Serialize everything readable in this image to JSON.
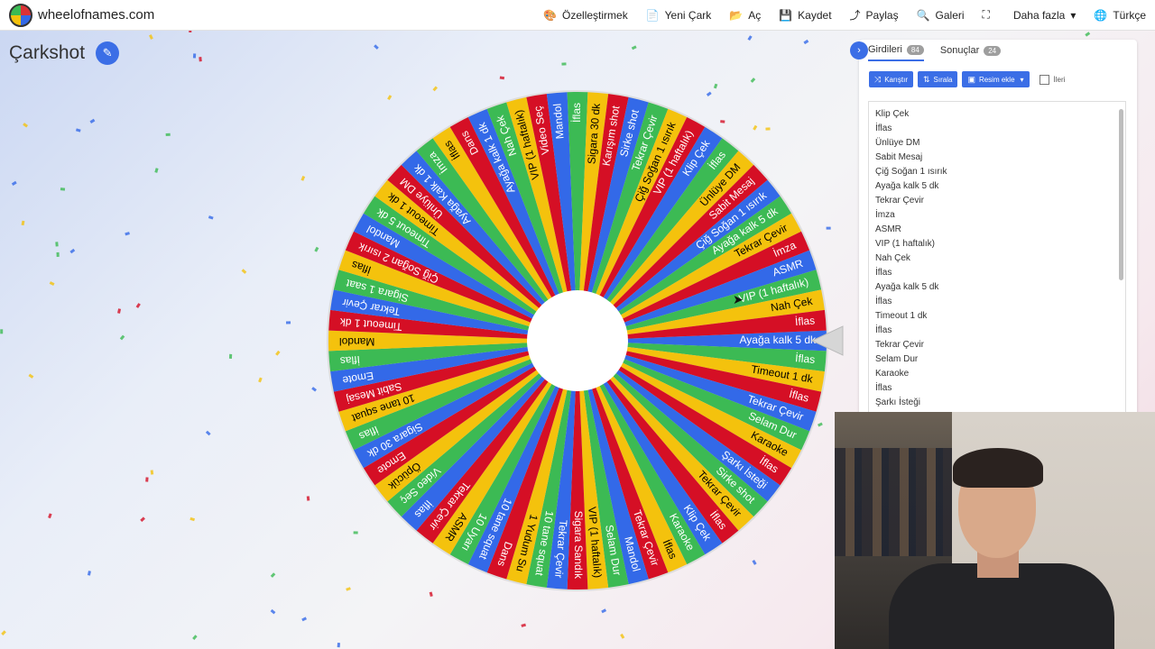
{
  "site": {
    "name": "wheelofnames.com"
  },
  "nav": [
    {
      "icon": "palette-icon",
      "glyph": "🎨",
      "label": "Özelleştirmek"
    },
    {
      "icon": "file-icon",
      "glyph": "📄",
      "label": "Yeni Çark"
    },
    {
      "icon": "folder-open-icon",
      "glyph": "📂",
      "label": "Aç"
    },
    {
      "icon": "save-icon",
      "glyph": "💾",
      "label": "Kaydet"
    },
    {
      "icon": "share-icon",
      "glyph": "⤴",
      "label": "Paylaş"
    },
    {
      "icon": "search-icon",
      "glyph": "🔍",
      "label": "Galeri"
    },
    {
      "icon": "fullscreen-icon",
      "glyph": "⛶",
      "label": ""
    },
    {
      "icon": "chevron-down-icon",
      "glyph": "▾",
      "label": "Daha fazla"
    },
    {
      "icon": "globe-icon",
      "glyph": "🌐",
      "label": "Türkçe"
    }
  ],
  "wheel": {
    "title": "Çarkshot",
    "colors": [
      "#3369e8",
      "#3cba54",
      "#f4c20d",
      "#d50f25"
    ],
    "segments": [
      "Ayağa kalk 5 dk",
      "İflas",
      "Timeout 1 dk",
      "İflas",
      "Tekrar Çevir",
      "Selam Dur",
      "Karaoke",
      "İflas",
      "Şarkı İsteği",
      "Sirke shot",
      "Tekrar Çevir",
      "İflas",
      "Klip Çek",
      "Karaoke",
      "İflas",
      "Tekrar Çevir",
      "Mandol",
      "Selam Dur",
      "VIP (1 haftalık)",
      "Sigara Sandık",
      "Tekrar Çevir",
      "10 tane squat",
      "1 Yudum Su",
      "Dans",
      "10 tane squat",
      "10 Uyarı",
      "ASMR",
      "Tekrar Çevir",
      "İflas",
      "Video Seç",
      "Öpücük",
      "Emote",
      "Sigara 30 dk",
      "İflas",
      "10 tane squat",
      "Sabit Mesaj",
      "Emote",
      "İflas",
      "Mandol",
      "Timeout 1 dk",
      "Tekrar Çevir",
      "Sigara 1 saat",
      "İflas",
      "Çiğ Soğan 2 ısırık",
      "Mandol",
      "Timeout 5 dk",
      "Timeout 1 dk",
      "Ünlüye DM",
      "Ayağa Kalk 1 dk",
      "İmza",
      "İflas",
      "Dans",
      "Ayağa kalk 1 dk",
      "Nah Çek",
      "VIP (1 haftalık)",
      "Video Seç",
      "Mandol",
      "İflas",
      "Sigara 30 dk",
      "Karışım shot",
      "Sirke shot",
      "Tekrar Çevir",
      "Çiğ Soğan 1 ısırık",
      "VIP (1 haftalık)",
      "Klip Çek",
      "İflas",
      "Ünlüye DM",
      "Sabit Mesaj",
      "Çiğ Soğan 1 ısırık",
      "Ayağa kalk 5 dk",
      "Tekrar Çevir",
      "İmza",
      "ASMR",
      "VIP (1 haftalık)",
      "Nah Çek",
      "İflas"
    ]
  },
  "panel": {
    "tabs": [
      {
        "label": "Girdileri",
        "count": "84"
      },
      {
        "label": "Sonuçlar",
        "count": "24"
      }
    ],
    "buttons": [
      {
        "icon": "shuffle-icon",
        "glyph": "⤨",
        "label": "Karıştır"
      },
      {
        "icon": "sort-icon",
        "glyph": "⇅",
        "label": "Sırala"
      },
      {
        "icon": "image-icon",
        "glyph": "🖼",
        "label": "Resim ekle"
      }
    ],
    "advanced_label": "İleri",
    "entries": [
      "Klip Çek",
      "İflas",
      "Ünlüye DM",
      "Sabit Mesaj",
      "Çiğ Soğan 1 ısırık",
      "Ayağa kalk 5 dk",
      "Tekrar Çevir",
      "İmza",
      "ASMR",
      "VIP (1 haftalık)",
      "Nah Çek",
      "İflas",
      "Ayağa kalk 5 dk",
      "İflas",
      "Timeout 1 dk",
      "İflas",
      "Tekrar Çevir",
      "Selam Dur",
      "Karaoke",
      "İflas",
      "Şarkı İsteği"
    ]
  }
}
